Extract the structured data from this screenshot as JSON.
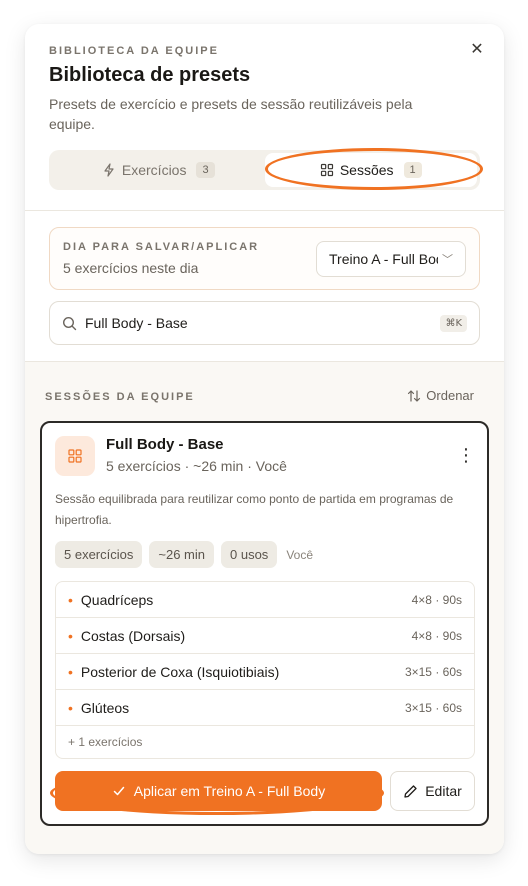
{
  "header": {
    "overline": "BIBLIOTECA DA EQUIPE",
    "title": "Biblioteca de presets",
    "description": "Presets de exercício e presets de sessão reutilizáveis pela equipe."
  },
  "tabs": [
    {
      "label": "Exercícios",
      "count": "3",
      "active": false,
      "icon": "lightning-icon"
    },
    {
      "label": "Sessões",
      "count": "1",
      "active": true,
      "icon": "grid-icon"
    }
  ],
  "day_picker": {
    "label": "DIA PARA SALVAR/APLICAR",
    "subtitle": "5 exercícios neste dia",
    "selected": "Treino A - Full Body"
  },
  "search": {
    "value": "Full Body - Base",
    "shortcut": "⌘K"
  },
  "section": {
    "title": "SESSÕES DA EQUIPE",
    "sort_label": "Ordenar"
  },
  "preset": {
    "title": "Full Body - Base",
    "meta": "5 exercícios · ~26 min · Você",
    "description": "Sessão equilibrada para reutilizar como ponto de partida em programas de hipertrofia.",
    "chips": [
      "5 exercícios",
      "~26 min",
      "0 usos"
    ],
    "owner": "Você",
    "exercises": [
      {
        "name": "Quadríceps",
        "sets": "4×8 · 90s"
      },
      {
        "name": "Costas (Dorsais)",
        "sets": "4×8 · 90s"
      },
      {
        "name": "Posterior de Coxa (Isquiotibiais)",
        "sets": "3×15 · 60s"
      },
      {
        "name": "Glúteos",
        "sets": "3×15 · 60s"
      }
    ],
    "more_label": "+ 1 exercícios",
    "apply_label": "Aplicar em Treino A - Full Body",
    "edit_label": "Editar"
  },
  "colors": {
    "accent": "#f07222",
    "card_border": "#2c2a27"
  }
}
